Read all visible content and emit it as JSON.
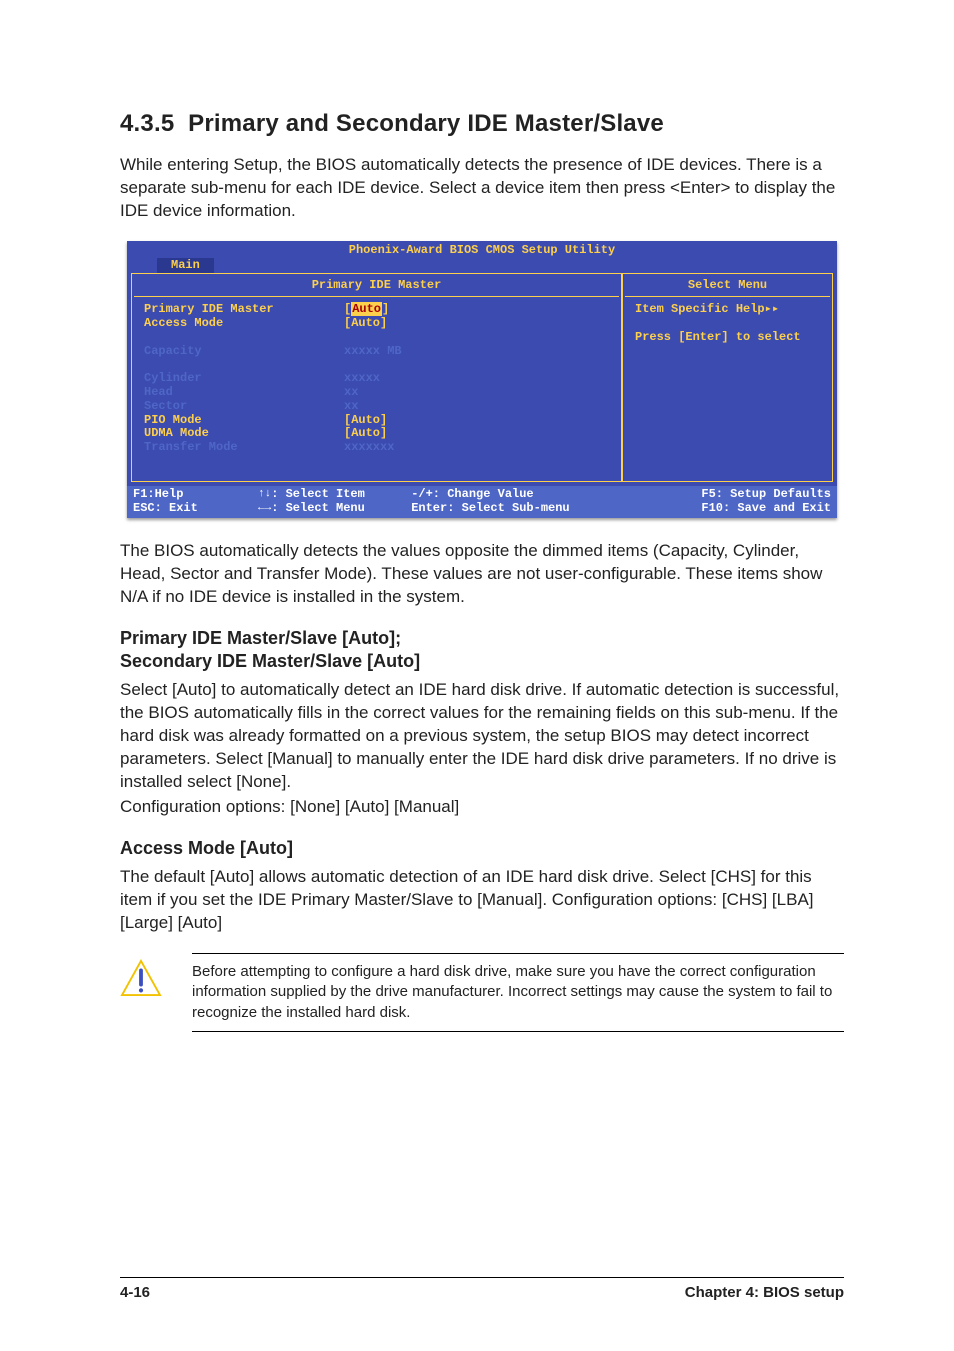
{
  "section": {
    "num": "4.3.5",
    "title": "Primary and Secondary IDE Master/Slave",
    "intro": "While entering Setup, the BIOS automatically detects the presence of IDE devices. There is a separate sub-menu for each IDE device. Select a device item then press <Enter> to display the IDE device information."
  },
  "bios": {
    "utility_title": "Phoenix-Award BIOS CMOS Setup Utility",
    "tab": "Main",
    "left_header": "Primary IDE Master",
    "right_header": "Select Menu",
    "rows": [
      {
        "label": "Primary IDE Master",
        "value": "[Auto]",
        "dim": false,
        "selected": true
      },
      {
        "label": "Access Mode",
        "value": "[Auto]",
        "dim": false
      },
      {
        "label": "",
        "value": "",
        "spacer": true
      },
      {
        "label": "Capacity",
        "value": "xxxxx MB",
        "dim": true
      },
      {
        "label": "",
        "value": "",
        "spacer": true
      },
      {
        "label": "Cylinder",
        "value": "xxxxx",
        "dim": true
      },
      {
        "label": "Head",
        "value": "   xx",
        "dim": true
      },
      {
        "label": "Sector",
        "value": "   xx",
        "dim": true
      },
      {
        "label": "PIO Mode",
        "value": "[Auto]",
        "dim": false
      },
      {
        "label": "UDMA Mode",
        "value": "[Auto]",
        "dim": false
      },
      {
        "label": "Transfer Mode",
        "value": "xxxxxxx",
        "dim": true
      }
    ],
    "help_line1": "Item Specific Help▸▸",
    "help_line2": "Press [Enter] to select",
    "footer": {
      "r1c1": "F1:Help",
      "r1c2": ": Select Item",
      "r1c3": "-/+:  Change Value",
      "r1c4": "F5: Setup Defaults",
      "r2c1": "ESC: Exit",
      "r2c2": ": Select Menu",
      "r2c3": "Enter: Select Sub-menu",
      "r2c4": "F10: Save and Exit"
    }
  },
  "after_bios": "The BIOS automatically detects the values opposite the dimmed items (Capacity, Cylinder,  Head, Sector and Transfer Mode). These values are not user-configurable. These items show N/A if no IDE device is installed in the system.",
  "sub1": {
    "heading_line1": "Primary IDE Master/Slave [Auto];",
    "heading_line2": "Secondary IDE Master/Slave [Auto]",
    "body": "Select [Auto] to automatically detect an IDE hard disk drive. If automatic detection is successful, the BIOS automatically fills in the correct values for the remaining fields on this sub-menu. If the hard disk was already formatted on a previous system, the setup BIOS may detect incorrect parameters. Select [Manual] to manually enter the IDE hard disk drive parameters. If no drive is installed select [None].",
    "config": "Configuration options: [None] [Auto] [Manual]"
  },
  "sub2": {
    "heading": "Access Mode [Auto]",
    "body": "The default [Auto] allows automatic detection of an IDE hard disk drive. Select [CHS] for this item if you set the IDE Primary Master/Slave to [Manual]. Configuration options: [CHS] [LBA] [Large] [Auto]"
  },
  "warning": "Before attempting to configure a hard disk drive, make sure you have the correct configuration information supplied by the drive manufacturer. Incorrect settings may cause the system to fail to recognize the installed hard disk.",
  "footer": {
    "page": "4-16",
    "chapter": "Chapter 4: BIOS setup"
  }
}
